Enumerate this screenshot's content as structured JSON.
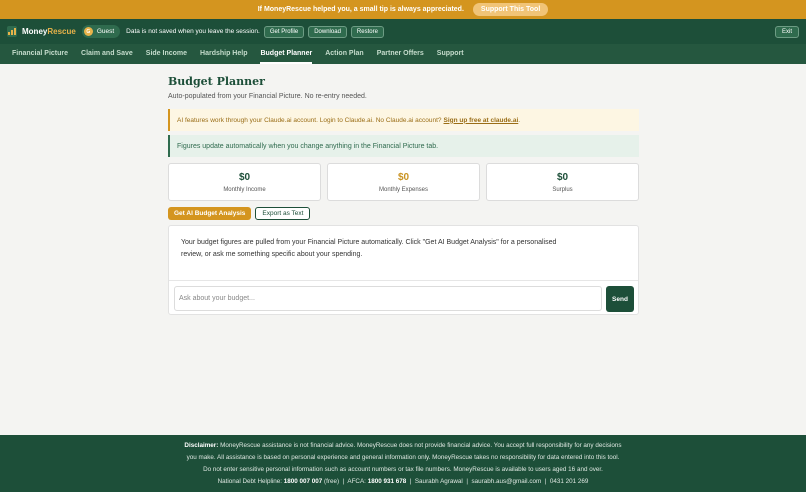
{
  "banner": {
    "text": "If MoneyRescue helped you, a small tip is always appreciated.",
    "support_label": "Support This Tool"
  },
  "header": {
    "brand_part1": "Money",
    "brand_part2": "Rescue",
    "user_initial": "G",
    "user_name": "Guest",
    "notice": "Data is not saved when you leave the session.",
    "buttons": [
      "Get Profile",
      "Download",
      "Restore"
    ],
    "exit_label": "Exit"
  },
  "nav": {
    "tabs": [
      "Financial Picture",
      "Claim and Save",
      "Side Income",
      "Hardship Help",
      "Budget Planner",
      "Action Plan",
      "Partner Offers",
      "Support"
    ],
    "active": "Budget Planner"
  },
  "page": {
    "title": "Budget Planner",
    "subtitle": "Auto-populated from your Financial Picture. No re-entry needed.",
    "warn_text": "AI features work through your Claude.ai account. Login to Claude.ai. No Claude.ai account?",
    "warn_link": "Sign up free at claude.ai",
    "warn_tail": ".",
    "info_text": "Figures update automatically when you change anything in the Financial Picture tab."
  },
  "stats": [
    {
      "value": "$0",
      "label": "Monthly Income",
      "color": "#1d4f39"
    },
    {
      "value": "$0",
      "label": "Monthly Expenses",
      "color": "#c99322"
    },
    {
      "value": "$0",
      "label": "Surplus",
      "color": "#1d4f39"
    }
  ],
  "actions": {
    "primary_label": "Get AI Budget Analysis",
    "export_label": "Export as Text"
  },
  "chat": {
    "message": "Your budget figures are pulled from your Financial Picture automatically. Click \"Get AI Budget Analysis\" for a personalised review, or ask me something specific about your spending.",
    "input_placeholder": "Ask about your budget...",
    "send_label": "Send"
  },
  "footer": {
    "disclaimer_label": "Disclaimer:",
    "line1": "MoneyRescue assistance is not financial advice. MoneyRescue does not provide financial advice. You accept full responsibility for any decisions",
    "line2": "you make. All assistance is based on personal experience and general information only. MoneyRescue takes no responsibility for data entered into this tool.",
    "line3": "Do not enter sensitive personal information such as account numbers or tax file numbers. MoneyRescue is available to users aged 16 and over.",
    "helpline_label": "National Debt Helpline:",
    "helpline_number": "1800 007 007",
    "helpline_note": "(free)",
    "afca_label": "AFCA:",
    "afca_number": "1800 931 678",
    "author": "Saurabh Agrawal",
    "email": "saurabh.aus@gmail.com",
    "phone": "0431 201 269"
  }
}
